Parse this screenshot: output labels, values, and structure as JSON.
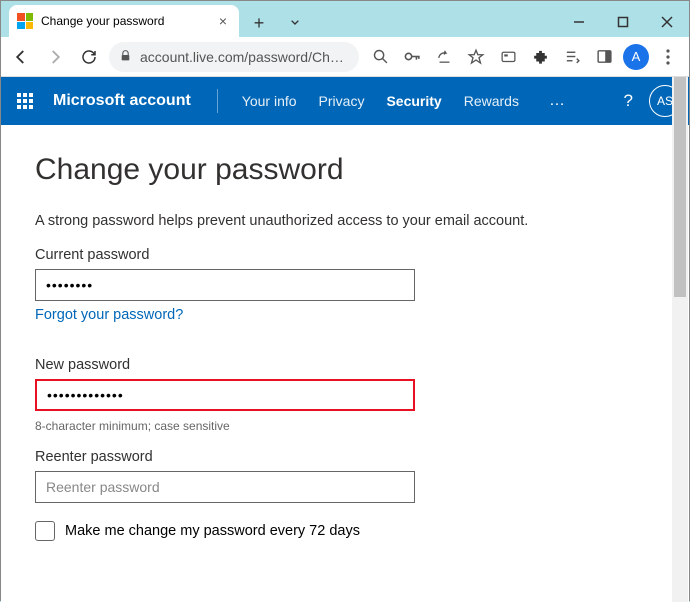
{
  "browser": {
    "tab_title": "Change your password",
    "url": "account.live.com/password/Chang…",
    "profile_initial": "A"
  },
  "header": {
    "brand": "Microsoft account",
    "nav": {
      "your_info": "Your info",
      "privacy": "Privacy",
      "security": "Security",
      "rewards": "Rewards"
    },
    "more": "…",
    "help": "?",
    "avatar_initials": "AS"
  },
  "page": {
    "title": "Change your password",
    "subtitle": "A strong password helps prevent unauthorized access to your email account.",
    "current": {
      "label": "Current password",
      "value": "••••••••",
      "forgot_link": "Forgot your password?"
    },
    "new": {
      "label": "New password",
      "value": "•••••••••••••",
      "hint": "8-character minimum; case sensitive"
    },
    "reenter": {
      "label": "Reenter password",
      "placeholder": "Reenter password",
      "value": ""
    },
    "checkbox_label": "Make me change my password every 72 days"
  }
}
